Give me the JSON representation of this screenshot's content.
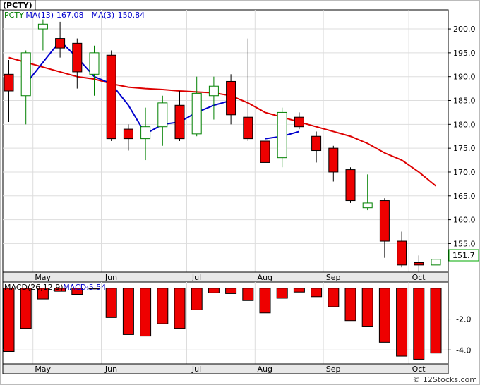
{
  "chart_data": [
    {
      "type": "candlestick",
      "ticker_label": "(PCTY)",
      "legend": [
        {
          "label": "PCTY",
          "color": "#008000"
        },
        {
          "label": "MA(13)",
          "value": "167.08",
          "color": "#0000cc"
        },
        {
          "label": "MA(3)",
          "value": "150.84",
          "color": "#0000cc"
        }
      ],
      "ylim": [
        149,
        204
      ],
      "y_ticks": [
        "155.0",
        "160.0",
        "165.0",
        "170.0",
        "175.0",
        "180.0",
        "185.0",
        "190.0",
        "195.0",
        "200.0"
      ],
      "month_labels": [
        {
          "label": "May",
          "index": 1
        },
        {
          "label": "Jun",
          "index": 5
        },
        {
          "label": "Jul",
          "index": 10
        },
        {
          "label": "Aug",
          "index": 14
        },
        {
          "label": "Sep",
          "index": 18
        },
        {
          "label": "Oct",
          "index": 23
        }
      ],
      "last_price_label": "151.7",
      "candles": [
        {
          "o": 190.5,
          "h": 193.5,
          "l": 180.5,
          "c": 187.0
        },
        {
          "o": 186.0,
          "h": 195.5,
          "l": 180.0,
          "c": 195.0
        },
        {
          "o": 200.0,
          "h": 202.0,
          "l": 195.5,
          "c": 201.0
        },
        {
          "o": 198.0,
          "h": 201.5,
          "l": 194.0,
          "c": 196.0
        },
        {
          "o": 197.0,
          "h": 198.0,
          "l": 187.5,
          "c": 191.0
        },
        {
          "o": 190.5,
          "h": 196.5,
          "l": 186.0,
          "c": 195.0
        },
        {
          "o": 194.5,
          "h": 195.5,
          "l": 176.5,
          "c": 177.0
        },
        {
          "o": 179.0,
          "h": 180.0,
          "l": 174.5,
          "c": 177.0
        },
        {
          "o": 177.0,
          "h": 183.5,
          "l": 172.5,
          "c": 179.5
        },
        {
          "o": 179.5,
          "h": 186.0,
          "l": 175.5,
          "c": 184.5
        },
        {
          "o": 184.0,
          "h": 187.0,
          "l": 176.5,
          "c": 177.0
        },
        {
          "o": 178.0,
          "h": 190.0,
          "l": 177.5,
          "c": 186.5
        },
        {
          "o": 186.0,
          "h": 190.0,
          "l": 181.0,
          "c": 188.0
        },
        {
          "o": 189.0,
          "h": 190.5,
          "l": 180.0,
          "c": 182.0
        },
        {
          "o": 181.5,
          "h": 198.0,
          "l": 176.5,
          "c": 177.0
        },
        {
          "o": 176.5,
          "h": 177.0,
          "l": 169.5,
          "c": 172.0
        },
        {
          "o": 173.0,
          "h": 183.5,
          "l": 171.0,
          "c": 182.5
        },
        {
          "o": 181.5,
          "h": 182.5,
          "l": 179.0,
          "c": 179.5
        },
        {
          "o": 177.5,
          "h": 178.5,
          "l": 172.0,
          "c": 174.5
        },
        {
          "o": 175.0,
          "h": 175.5,
          "l": 168.0,
          "c": 170.0
        },
        {
          "o": 170.5,
          "h": 171.0,
          "l": 163.5,
          "c": 164.0
        },
        {
          "o": 162.5,
          "h": 169.5,
          "l": 162.0,
          "c": 163.5
        },
        {
          "o": 164.0,
          "h": 164.5,
          "l": 152.0,
          "c": 155.5
        },
        {
          "o": 155.5,
          "h": 157.5,
          "l": 150.0,
          "c": 150.5
        },
        {
          "o": 151.0,
          "h": 152.5,
          "l": 147.5,
          "c": 150.5
        },
        {
          "o": 150.5,
          "h": 152.0,
          "l": 150.0,
          "c": 151.7
        }
      ],
      "series": [
        {
          "name": "MA(13)",
          "color": "#dd0000",
          "values": [
            194.0,
            193.0,
            192.0,
            191.0,
            190.0,
            189.5,
            188.5,
            187.8,
            187.5,
            187.3,
            187.0,
            186.8,
            186.6,
            186.0,
            184.5,
            182.5,
            181.5,
            180.5,
            179.5,
            178.5,
            177.5,
            176.0,
            174.0,
            172.5,
            170.0,
            167.08
          ]
        },
        {
          "name": "MA(3)",
          "color": "#0000cc",
          "values": [
            null,
            188.5,
            193.0,
            197.5,
            194.0,
            190.0,
            188.5,
            184.0,
            178.0,
            180.0,
            180.5,
            182.5,
            184.0,
            185.0,
            null,
            177.0,
            177.5,
            178.5,
            null,
            null,
            null,
            null,
            null,
            null,
            null,
            null
          ]
        }
      ]
    },
    {
      "type": "bar",
      "legend": [
        {
          "label": "MACD(26,12,9)",
          "color": "#000000"
        },
        {
          "label": "MACD:",
          "value": "-5.54",
          "color": "#0000cc"
        }
      ],
      "ylim": [
        -4.9,
        0.4
      ],
      "y_ticks": [
        "-2.0",
        "-4.0"
      ],
      "month_labels": [
        "May",
        "Jun",
        "Jul",
        "Aug",
        "Sep",
        "Oct"
      ],
      "values": [
        -4.1,
        -2.6,
        -0.7,
        -0.2,
        -0.4,
        -0.05,
        -1.9,
        -3.0,
        -3.1,
        -2.3,
        -2.6,
        -1.4,
        -0.3,
        -0.35,
        -0.8,
        -1.6,
        -0.65,
        -0.25,
        -0.55,
        -1.2,
        -2.1,
        -2.5,
        -3.5,
        -4.4,
        -4.6,
        -4.2
      ]
    }
  ],
  "watermark": "© 12Stocks.com"
}
